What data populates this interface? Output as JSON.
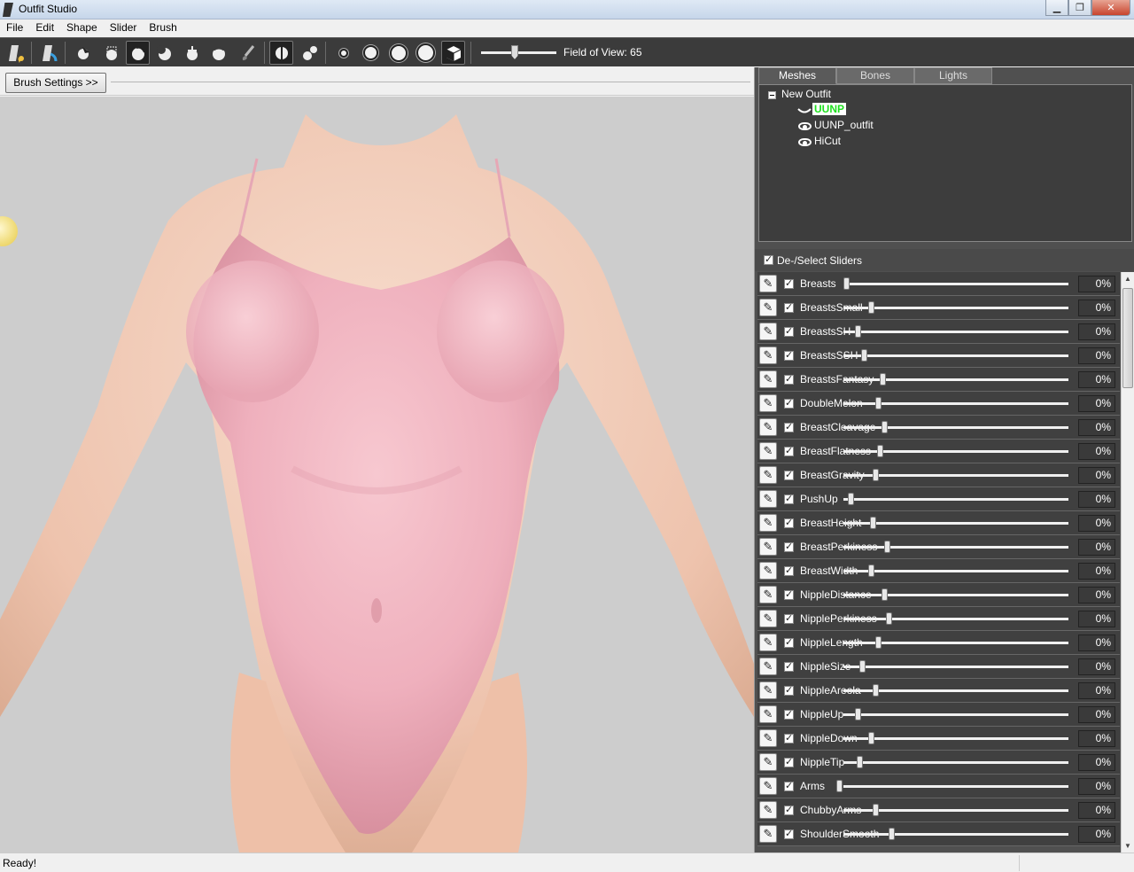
{
  "window": {
    "title": "Outfit Studio",
    "buttons": {
      "minimize": "▁",
      "maximize": "❐",
      "close": "✕"
    }
  },
  "menu": [
    "File",
    "Edit",
    "Shape",
    "Slider",
    "Brush"
  ],
  "toolbar": {
    "fov_label": "Field of View: 65",
    "fov_value": 65
  },
  "brush_settings_label": "Brush Settings >>",
  "tabs": [
    "Meshes",
    "Bones",
    "Lights"
  ],
  "tree": {
    "root": "New Outfit",
    "items": [
      {
        "label": "UUNP",
        "selected": true
      },
      {
        "label": "UUNP_outfit",
        "selected": false
      },
      {
        "label": "HiCut",
        "selected": false
      }
    ]
  },
  "sliders_header": "De-/Select Sliders",
  "sliders": [
    {
      "name": "Breasts",
      "value": "0%",
      "thumb": 0.0
    },
    {
      "name": "BreastsSmall",
      "value": "0%",
      "thumb": 0.11
    },
    {
      "name": "BreastsSH",
      "value": "0%",
      "thumb": 0.05
    },
    {
      "name": "BreastsSSH",
      "value": "0%",
      "thumb": 0.08
    },
    {
      "name": "BreastsFantasy",
      "value": "0%",
      "thumb": 0.16
    },
    {
      "name": "DoubleMelon",
      "value": "0%",
      "thumb": 0.14
    },
    {
      "name": "BreastCleavage",
      "value": "0%",
      "thumb": 0.17
    },
    {
      "name": "BreastFlatness",
      "value": "0%",
      "thumb": 0.15
    },
    {
      "name": "BreastGravity",
      "value": "0%",
      "thumb": 0.13
    },
    {
      "name": "PushUp",
      "value": "0%",
      "thumb": 0.02
    },
    {
      "name": "BreastHeight",
      "value": "0%",
      "thumb": 0.12
    },
    {
      "name": "BreastPerkiness",
      "value": "0%",
      "thumb": 0.18
    },
    {
      "name": "BreastWidth",
      "value": "0%",
      "thumb": 0.11
    },
    {
      "name": "NippleDistance",
      "value": "0%",
      "thumb": 0.17
    },
    {
      "name": "NipplePerkiness",
      "value": "0%",
      "thumb": 0.19
    },
    {
      "name": "NippleLength",
      "value": "0%",
      "thumb": 0.14
    },
    {
      "name": "NippleSize",
      "value": "0%",
      "thumb": 0.07
    },
    {
      "name": "NippleAreola",
      "value": "0%",
      "thumb": 0.13
    },
    {
      "name": "NippleUp",
      "value": "0%",
      "thumb": 0.05
    },
    {
      "name": "NippleDown",
      "value": "0%",
      "thumb": 0.11
    },
    {
      "name": "NippleTip",
      "value": "0%",
      "thumb": 0.06
    },
    {
      "name": "Arms",
      "value": "0%",
      "thumb": -0.03
    },
    {
      "name": "ChubbyArms",
      "value": "0%",
      "thumb": 0.13
    },
    {
      "name": "ShoulderSmooth",
      "value": "0%",
      "thumb": 0.2
    }
  ],
  "status": "Ready!",
  "colors": {
    "toolbar_bg": "#3b3b3b",
    "panel_bg": "#505050",
    "viewport_bg": "#cdcdcd",
    "selected_text": "#1ee01e",
    "garment": "#f2b9c4",
    "skin": "#f1cfbd"
  }
}
